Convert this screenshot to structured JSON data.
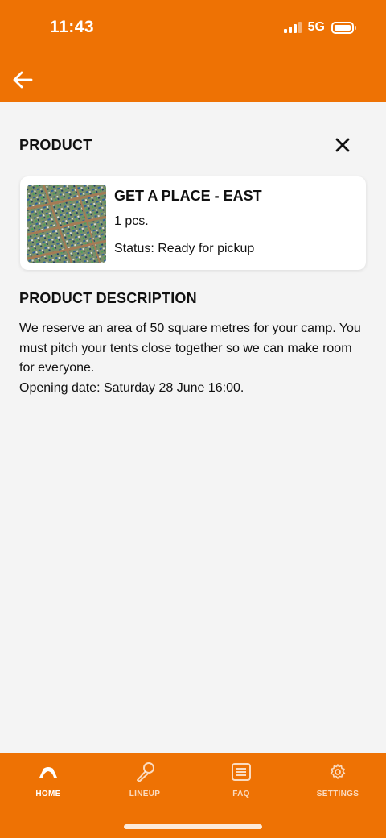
{
  "status_bar": {
    "time": "11:43",
    "network": "5G"
  },
  "colors": {
    "accent": "#ee7204",
    "background": "#f4f4f4",
    "card": "#ffffff"
  },
  "icons": {
    "back": "arrow-left-icon",
    "close": "close-x-icon"
  },
  "product_section": {
    "title": "PRODUCT"
  },
  "product_card": {
    "name": "GET A PLACE - EAST",
    "quantity": "1 pcs.",
    "status": "Status: Ready for pickup",
    "image": "aerial-campsite-photo"
  },
  "description_section": {
    "title": "PRODUCT DESCRIPTION",
    "lines": [
      "We reserve an area of 50 square metres for your camp. You must pitch your tents close together so we can make room for everyone.",
      "Opening date: Saturday 28 June 16:00."
    ]
  },
  "tabs": [
    {
      "label": "HOME",
      "icon": "home-tent-icon",
      "active": true
    },
    {
      "label": "LINEUP",
      "icon": "microphone-icon",
      "active": false
    },
    {
      "label": "FAQ",
      "icon": "list-document-icon",
      "active": false
    },
    {
      "label": "SETTINGS",
      "icon": "gear-icon",
      "active": false
    }
  ]
}
